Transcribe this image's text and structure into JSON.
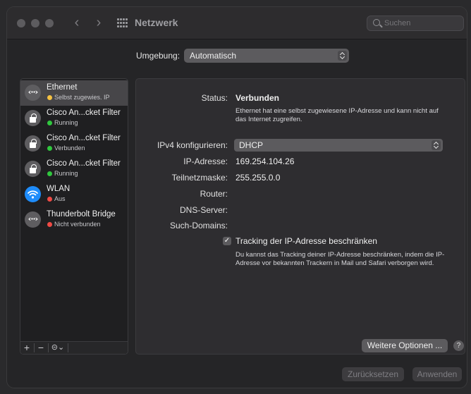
{
  "window": {
    "title": "Netzwerk"
  },
  "search": {
    "placeholder": "Suchen"
  },
  "umgebung": {
    "label": "Umgebung:",
    "value": "Automatisch"
  },
  "sidebar": {
    "services": [
      {
        "name": "Ethernet",
        "status": "Selbst zugewies. IP",
        "status_color": "#f5c242",
        "icon": "ethernet-icon",
        "selected": true
      },
      {
        "name": "Cisco An...cket Filter",
        "status": "Running",
        "status_color": "#30c73e",
        "icon": "lock-icon"
      },
      {
        "name": "Cisco An...cket Filter",
        "status": "Verbunden",
        "status_color": "#30c73e",
        "icon": "lock-icon"
      },
      {
        "name": "Cisco An...cket Filter",
        "status": "Running",
        "status_color": "#30c73e",
        "icon": "lock-icon"
      },
      {
        "name": "WLAN",
        "status": "Aus",
        "status_color": "#f04a45",
        "icon": "wifi-icon"
      },
      {
        "name": "Thunderbolt Bridge",
        "status": "Nicht verbunden",
        "status_color": "#f04a45",
        "icon": "ethernet-icon"
      }
    ],
    "footer": {
      "add": "+",
      "remove": "−",
      "action": "⊝⌄"
    }
  },
  "detail": {
    "status_label": "Status:",
    "status_value": "Verbunden",
    "status_desc": "Ethernet hat eine selbst zugewiesene IP-Adresse und kann nicht auf das Internet zugreifen.",
    "ipv4_label": "IPv4 konfigurieren:",
    "ipv4_value": "DHCP",
    "ip_label": "IP-Adresse:",
    "ip_value": "169.254.104.26",
    "mask_label": "Teilnetzmaske:",
    "mask_value": "255.255.0.0",
    "router_label": "Router:",
    "router_value": "",
    "dns_label": "DNS-Server:",
    "dns_value": "",
    "search_domains_label": "Such-Domains:",
    "search_domains_value": "",
    "tracking_checked": true,
    "tracking_label": "Tracking der IP-Adresse beschränken",
    "tracking_desc": "Du kannst das Tracking deiner IP-Adresse beschränken, indem die IP-Adresse vor bekannten Trackern in Mail und Safari verborgen wird.",
    "more_button": "Weitere Optionen ...",
    "help": "?"
  },
  "footer": {
    "revert": "Zurücksetzen",
    "apply": "Anwenden"
  }
}
